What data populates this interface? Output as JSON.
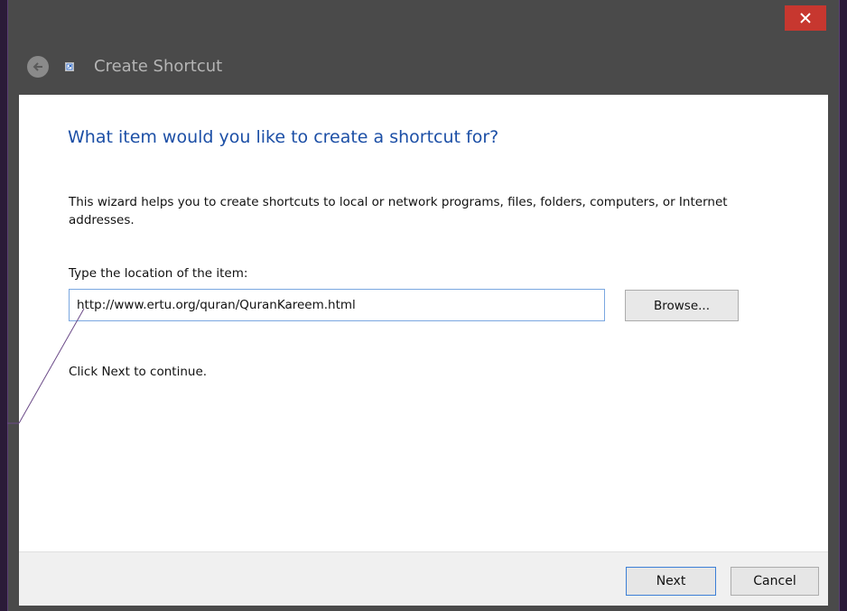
{
  "window": {
    "title": "Create Shortcut",
    "close_symbol": "×"
  },
  "wizard": {
    "heading": "What item would you like to create a shortcut for?",
    "description": "This wizard helps you to create shortcuts to local or network programs, files, folders, computers, or Internet addresses.",
    "location_label": "Type the location of the item:",
    "location_value": "http://www.ertu.org/quran/QuranKareem.html",
    "browse_label": "Browse...",
    "continue_hint": "Click Next to continue."
  },
  "footer": {
    "next_label": "Next",
    "cancel_label": "Cancel"
  },
  "icons": {
    "close": "close-icon",
    "back": "back-arrow-icon",
    "shortcut": "shortcut-icon"
  },
  "colors": {
    "heading": "#1c4fa6",
    "close_button": "#c7372f",
    "focus_border": "#3c7fd6",
    "annotation_line": "#5b3f73"
  }
}
